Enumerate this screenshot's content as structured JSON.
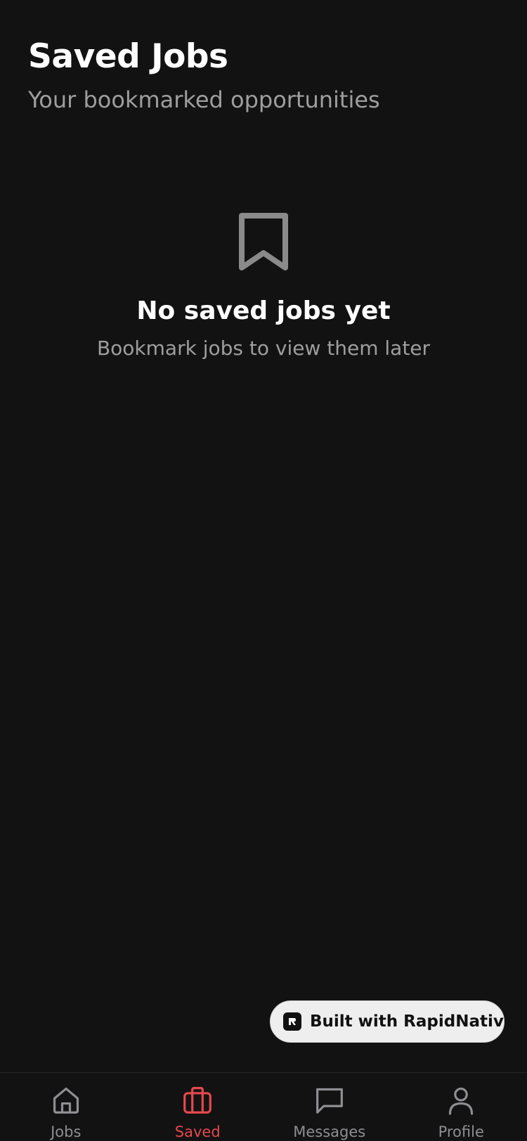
{
  "header": {
    "title": "Saved Jobs",
    "subtitle": "Your bookmarked opportunities"
  },
  "empty_state": {
    "icon": "bookmark-icon",
    "title": "No saved jobs yet",
    "message": "Bookmark jobs to view them later"
  },
  "badge": {
    "label": "Built with RapidNative",
    "icon": "rapidnative-logo"
  },
  "tabbar": {
    "active_color": "#e5484d",
    "inactive_color": "#8e8e93",
    "items": [
      {
        "label": "Jobs",
        "icon": "home-icon",
        "active": false
      },
      {
        "label": "Saved",
        "icon": "briefcase-icon",
        "active": true
      },
      {
        "label": "Messages",
        "icon": "message-icon",
        "active": false
      },
      {
        "label": "Profile",
        "icon": "user-icon",
        "active": false
      }
    ]
  },
  "colors": {
    "background": "#121212",
    "text_primary": "#ffffff",
    "text_secondary": "#9e9e9e",
    "accent": "#e5484d"
  }
}
